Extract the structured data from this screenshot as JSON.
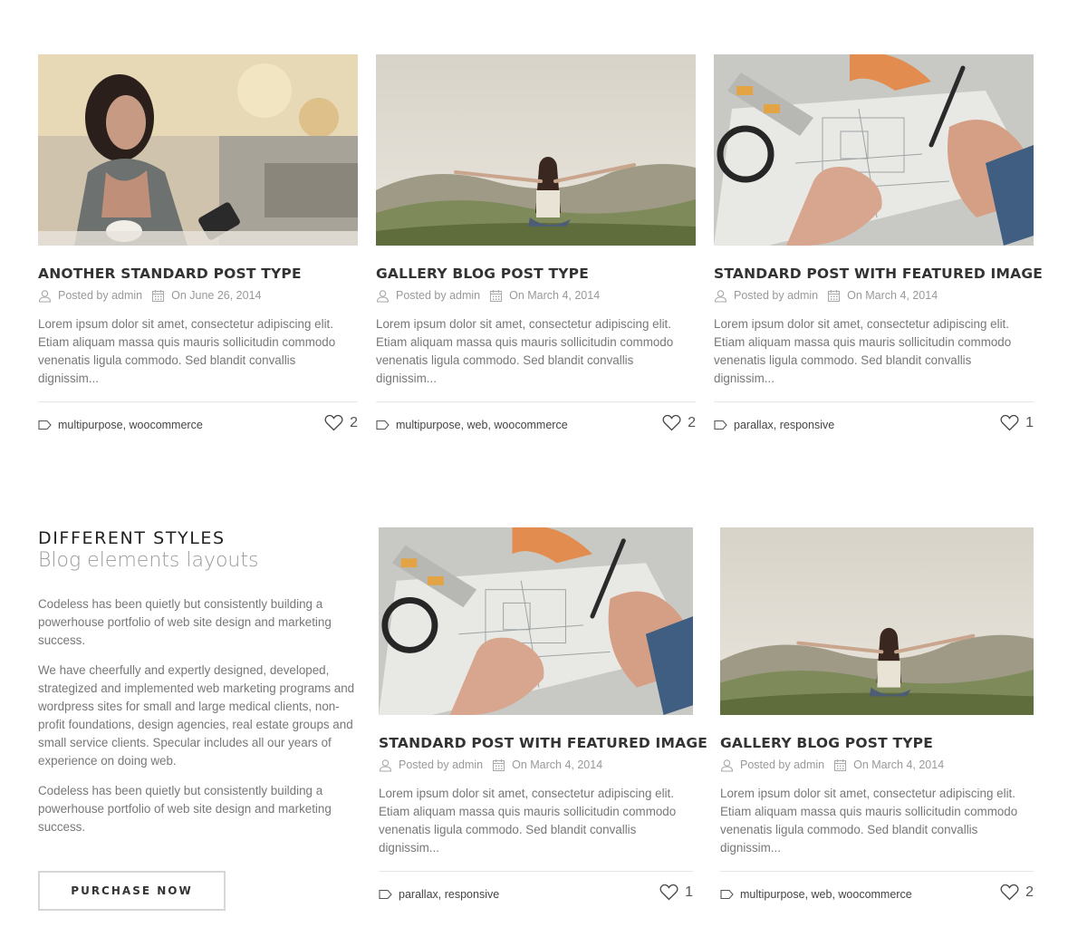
{
  "posts_row1": [
    {
      "title": "ANOTHER STANDARD POST TYPE",
      "author": "Posted by admin",
      "date": "On June 26, 2014",
      "excerpt": "Lorem ipsum dolor sit amet, consectetur adipiscing elit. Etiam aliquam massa quis mauris sollicitudin commodo venenatis ligula commodo. Sed blandit convallis dignissim...",
      "tags": "multipurpose, woocommerce",
      "likes": "2",
      "image": "woman-with-phone-photo"
    },
    {
      "title": "GALLERY BLOG POST TYPE",
      "author": "Posted by admin",
      "date": "On March 4, 2014",
      "excerpt": "Lorem ipsum dolor sit amet, consectetur adipiscing elit. Etiam aliquam massa quis mauris sollicitudin commodo venenatis ligula commodo. Sed blandit convallis dignissim...",
      "tags": "multipurpose, web, woocommerce",
      "likes": "2",
      "image": "woman-on-hill-photo"
    },
    {
      "title": "STANDARD POST WITH FEATURED IMAGE",
      "author": "Posted by admin",
      "date": "On March 4, 2014",
      "excerpt": "Lorem ipsum dolor sit amet, consectetur adipiscing elit. Etiam aliquam massa quis mauris sollicitudin commodo venenatis ligula commodo. Sed blandit convallis dignissim...",
      "tags": "parallax, responsive",
      "likes": "1",
      "image": "blueprint-drafting-photo"
    }
  ],
  "intro": {
    "heading": "DIFFERENT STYLES",
    "subheading": "Blog elements layouts",
    "paragraphs": [
      "Codeless has been quietly but consistently building a powerhouse portfolio of web site design and marketing success.",
      "We have cheerfully and expertly designed, developed, strategized and implemented web marketing programs and wordpress sites for small and large medical clients, non-profit foundations, design agencies, real estate groups and small service clients. Specular includes all our years of experience on doing web.",
      "Codeless has been quietly but consistently building a powerhouse portfolio of web site design and marketing success."
    ],
    "button_label": "PURCHASE NOW"
  },
  "posts_row2": [
    {
      "title": "STANDARD POST WITH FEATURED IMAGE",
      "author": "Posted by admin",
      "date": "On March 4, 2014",
      "excerpt": "Lorem ipsum dolor sit amet, consectetur adipiscing elit. Etiam aliquam massa quis mauris sollicitudin commodo venenatis ligula commodo. Sed blandit convallis dignissim...",
      "tags": "parallax, responsive",
      "likes": "1",
      "image": "blueprint-drafting-photo"
    },
    {
      "title": "GALLERY BLOG POST TYPE",
      "author": "Posted by admin",
      "date": "On March 4, 2014",
      "excerpt": "Lorem ipsum dolor sit amet, consectetur adipiscing elit. Etiam aliquam massa quis mauris sollicitudin commodo venenatis ligula commodo. Sed blandit convallis dignissim...",
      "tags": "multipurpose, web, woocommerce",
      "likes": "2",
      "image": "woman-on-hill-photo"
    }
  ],
  "colors": {
    "title": "#333333",
    "meta": "#999999",
    "body_text": "#777777",
    "divider": "#e6e6e6",
    "button_border": "#d6d6d6"
  },
  "icons": {
    "author": "user-icon",
    "date": "calendar-icon",
    "tags": "tag-icon",
    "likes": "heart-icon"
  }
}
